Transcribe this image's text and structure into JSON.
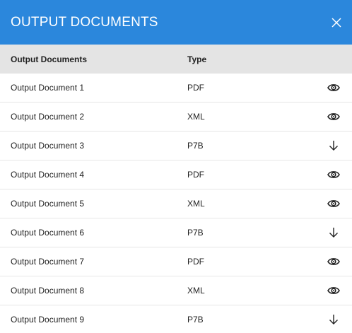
{
  "dialog": {
    "title": "OUTPUT DOCUMENTS",
    "close_icon": "close-icon"
  },
  "table": {
    "headers": {
      "name": "Output Documents",
      "type": "Type"
    },
    "rows": [
      {
        "name": "Output Document 1",
        "type": "PDF",
        "action_icon": "eye-icon"
      },
      {
        "name": "Output Document 2",
        "type": "XML",
        "action_icon": "eye-icon"
      },
      {
        "name": "Output Document 3",
        "type": "P7B",
        "action_icon": "download-icon"
      },
      {
        "name": "Output Document 4",
        "type": "PDF",
        "action_icon": "eye-icon"
      },
      {
        "name": "Output Document 5",
        "type": "XML",
        "action_icon": "eye-icon"
      },
      {
        "name": "Output Document 6",
        "type": "P7B",
        "action_icon": "download-icon"
      },
      {
        "name": "Output Document 7",
        "type": "PDF",
        "action_icon": "eye-icon"
      },
      {
        "name": "Output Document 8",
        "type": "XML",
        "action_icon": "eye-icon"
      },
      {
        "name": "Output Document 9",
        "type": "P7B",
        "action_icon": "download-icon"
      }
    ]
  },
  "colors": {
    "header_bg": "#2b87dc",
    "column_header_bg": "#e4e4e4",
    "row_divider": "#e6e6e6"
  }
}
